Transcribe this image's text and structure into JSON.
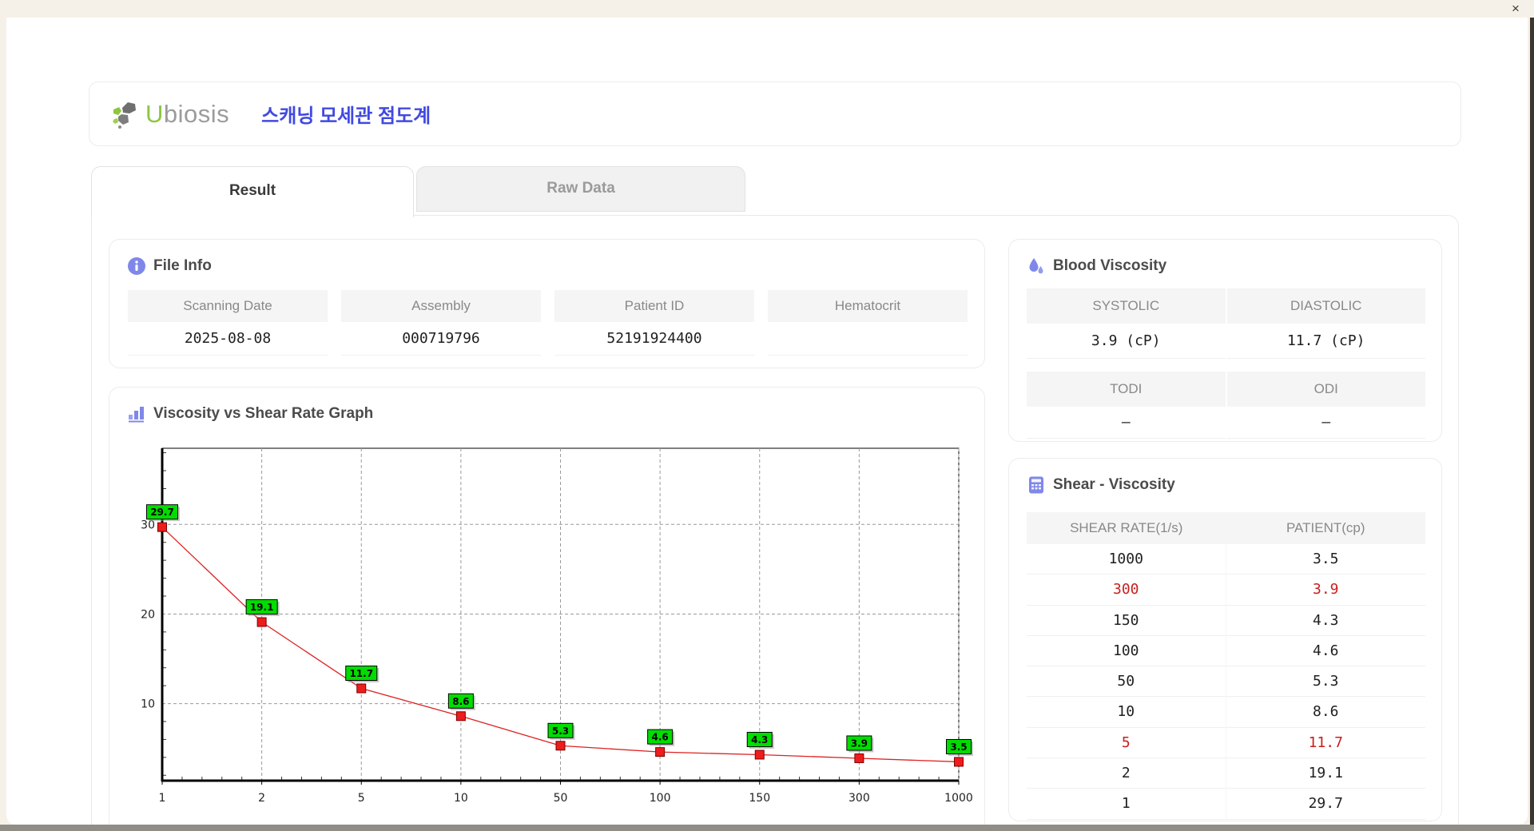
{
  "window": {
    "close_label": "×"
  },
  "header": {
    "logo_u": "U",
    "logo_rest": "biosis",
    "app_title_ko": "스캐닝 모세관 점도계"
  },
  "tabs": [
    {
      "label": "Result",
      "active": true
    },
    {
      "label": "Raw Data",
      "active": false
    }
  ],
  "file_info": {
    "title": "File Info",
    "fields": [
      {
        "label": "Scanning Date",
        "value": "2025-08-08"
      },
      {
        "label": "Assembly",
        "value": "000719796"
      },
      {
        "label": "Patient ID",
        "value": "52191924400"
      },
      {
        "label": "Hematocrit",
        "value": ""
      }
    ]
  },
  "blood_viscosity": {
    "title": "Blood Viscosity",
    "blocks": [
      {
        "headers": [
          "SYSTOLIC",
          "DIASTOLIC"
        ],
        "values": [
          "3.9 (cP)",
          "11.7 (cP)"
        ]
      },
      {
        "headers": [
          "TODI",
          "ODI"
        ],
        "values": [
          "–",
          "–"
        ]
      }
    ]
  },
  "graph": {
    "title": "Viscosity vs Shear Rate Graph"
  },
  "chart_data": {
    "type": "line",
    "title": "Viscosity vs Shear Rate Graph",
    "x": [
      1,
      2,
      5,
      10,
      50,
      100,
      150,
      300,
      1000
    ],
    "y": [
      29.7,
      19.1,
      11.7,
      8.6,
      5.3,
      4.6,
      4.3,
      3.9,
      3.5
    ],
    "point_labels": [
      "29.7",
      "19.1",
      "11.7",
      "8.6",
      "5.3",
      "4.6",
      "4.3",
      "3.9",
      "3.5"
    ],
    "x_tick_labels": [
      "1",
      "2",
      "5",
      "10",
      "50",
      "100",
      "150",
      "300",
      "1000"
    ],
    "y_ticks": [
      10,
      20,
      30
    ],
    "xlabel": "",
    "ylabel": "",
    "x_axis_type": "categorical-even-spacing",
    "ylim": [
      1.4,
      38.5
    ],
    "grid": true,
    "legend": false,
    "line_color": "#dd2222",
    "marker_color": "#ee1c1c",
    "marker_border": "#7a0000",
    "label_box_color": "#00dd00",
    "grid_color": "#9a9a9a"
  },
  "shear_viscosity": {
    "title": "Shear - Viscosity",
    "columns": [
      "SHEAR RATE(1/s)",
      "PATIENT(cp)"
    ],
    "rows": [
      {
        "shear": "1000",
        "patient": "3.5",
        "highlight": false
      },
      {
        "shear": "300",
        "patient": "3.9",
        "highlight": true
      },
      {
        "shear": "150",
        "patient": "4.3",
        "highlight": false
      },
      {
        "shear": "100",
        "patient": "4.6",
        "highlight": false
      },
      {
        "shear": "50",
        "patient": "5.3",
        "highlight": false
      },
      {
        "shear": "10",
        "patient": "8.6",
        "highlight": false
      },
      {
        "shear": "5",
        "patient": "11.7",
        "highlight": true
      },
      {
        "shear": "2",
        "patient": "19.1",
        "highlight": false
      },
      {
        "shear": "1",
        "patient": "29.7",
        "highlight": false
      }
    ]
  },
  "colors": {
    "accent_blue": "#4149e0",
    "icon_periwinkle": "#7f88e9",
    "logo_green": "#8dc63f",
    "highlight_red": "#c81e1e",
    "chrome_beige": "#f6f1e8",
    "chrome_bottom": "#8f8d85"
  }
}
